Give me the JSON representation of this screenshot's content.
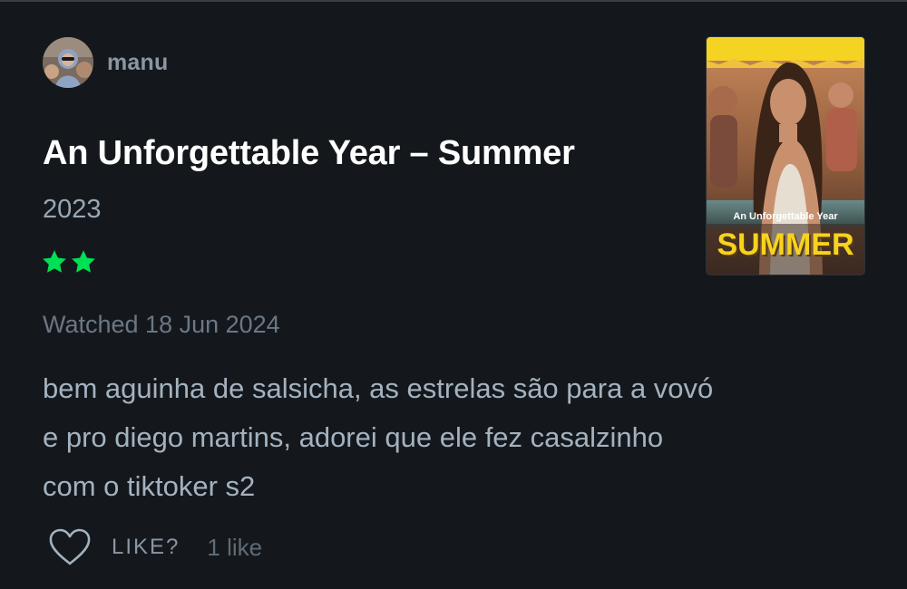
{
  "reviewer": {
    "username": "manu"
  },
  "film": {
    "title": "An Unforgettable Year – Summer",
    "year": "2023",
    "rating_stars": 2,
    "poster": {
      "title_small": "An Unforgettable Year",
      "title_big": "SUMMER"
    }
  },
  "review": {
    "watched": "Watched 18 Jun 2024",
    "lines": [
      "bem aguinha de salsicha, as estrelas são para a vovó",
      "e pro diego martins, adorei que ele fez casalzinho",
      "com o tiktoker s2"
    ]
  },
  "actions": {
    "like_label": "LIKE?",
    "like_count": "1 like"
  },
  "colors": {
    "background": "#14181c",
    "star": "#00e054",
    "accent_yellow": "#f6d31e"
  }
}
